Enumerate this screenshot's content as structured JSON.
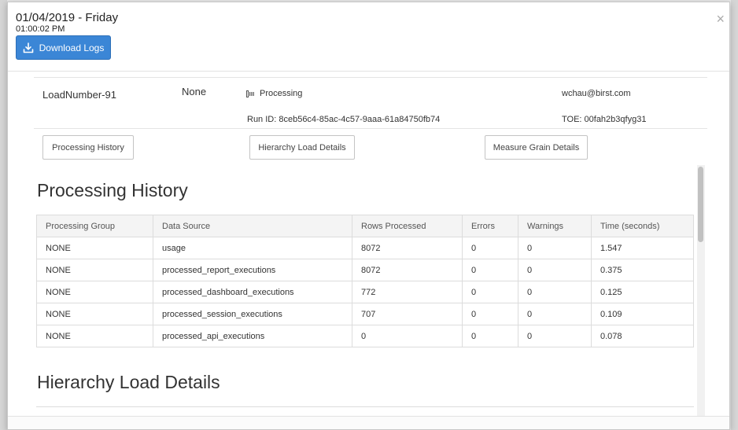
{
  "header": {
    "date_title": "01/04/2019 - Friday",
    "time": "01:00:02 PM",
    "download_label": "Download Logs",
    "close_label": "×"
  },
  "summary": {
    "load_name": "LoadNumber-91",
    "group": "None",
    "status": "Processing",
    "run_id": "Run ID: 8ceb56c4-85ac-4c57-9aaa-61a84750fb74",
    "email": "wchau@birst.com",
    "toe": "TOE: 00fah2b3qfyg31"
  },
  "nav": {
    "processing_history": "Processing History",
    "hierarchy_load_details": "Hierarchy Load Details",
    "measure_grain_details": "Measure Grain Details"
  },
  "sections": {
    "processing_history_title": "Processing History",
    "hierarchy_load_title": "Hierarchy Load Details"
  },
  "processing_table": {
    "columns": [
      "Processing Group",
      "Data Source",
      "Rows Processed",
      "Errors",
      "Warnings",
      "Time (seconds)"
    ],
    "rows": [
      [
        "NONE",
        "usage",
        "8072",
        "0",
        "0",
        "1.547"
      ],
      [
        "NONE",
        "processed_report_executions",
        "8072",
        "0",
        "0",
        "0.375"
      ],
      [
        "NONE",
        "processed_dashboard_executions",
        "772",
        "0",
        "0",
        "0.125"
      ],
      [
        "NONE",
        "processed_session_executions",
        "707",
        "0",
        "0",
        "0.109"
      ],
      [
        "NONE",
        "processed_api_executions",
        "0",
        "0",
        "0",
        "0.078"
      ]
    ]
  },
  "colors": {
    "primary_button": "#3b86d6",
    "text": "#333333",
    "border": "#dcdcdc"
  }
}
